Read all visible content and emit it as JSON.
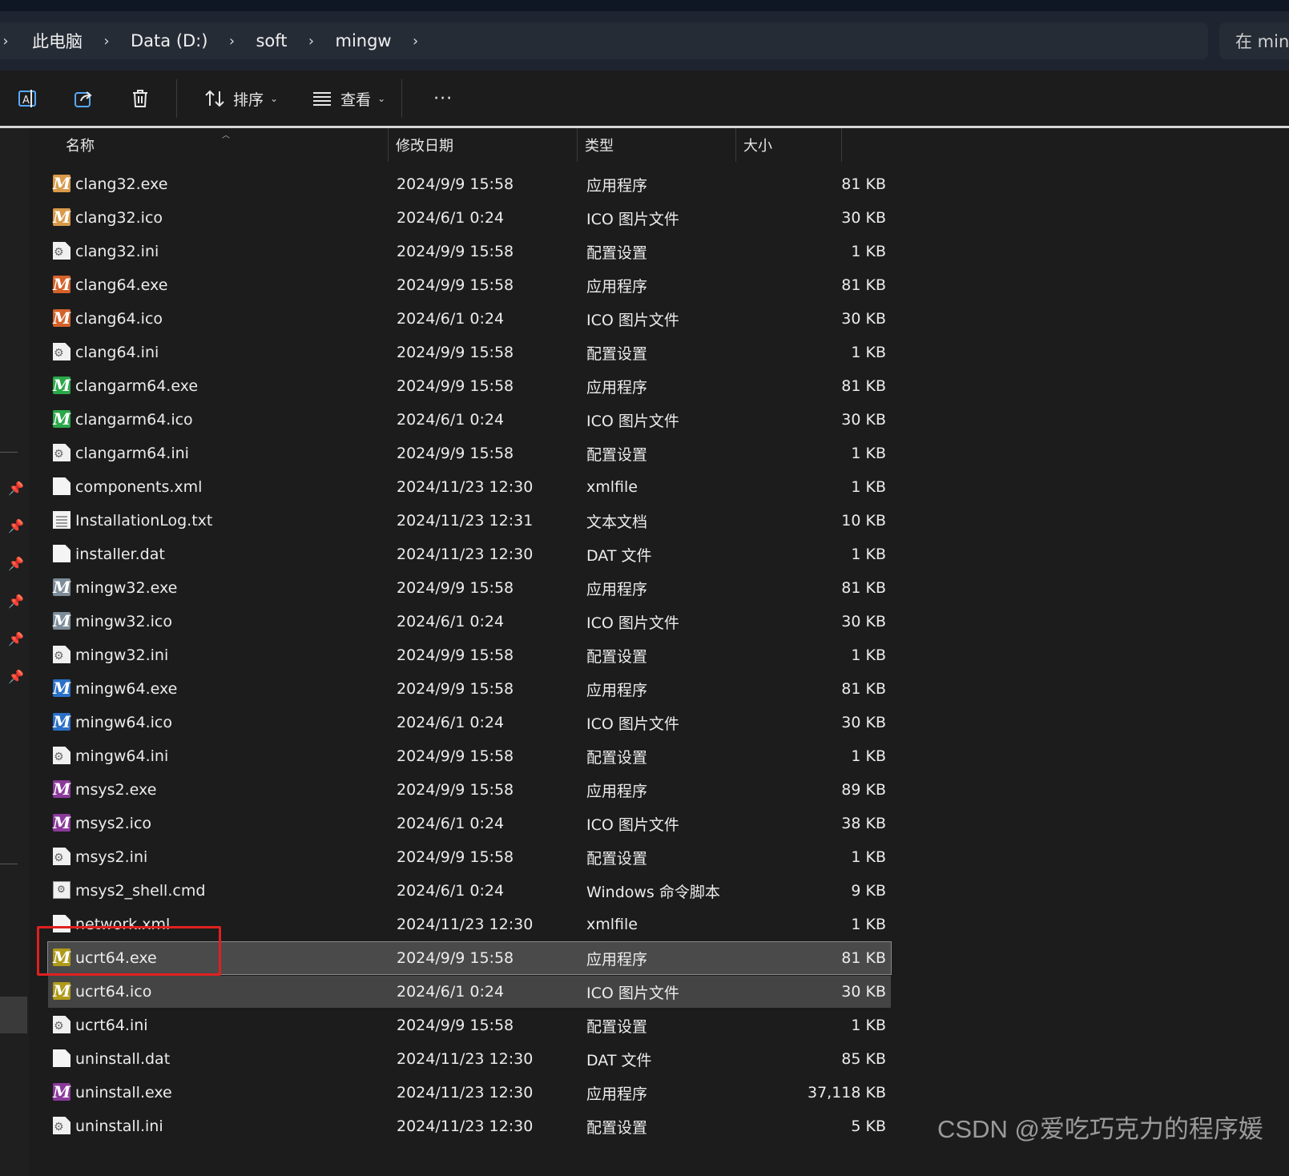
{
  "breadcrumb": {
    "items": [
      "此电脑",
      "Data (D:)",
      "soft",
      "mingw"
    ],
    "separator": "›"
  },
  "search": {
    "placeholder": "在 mingw"
  },
  "toolbar": {
    "sort_label": "排序",
    "view_label": "查看",
    "more_label": "···"
  },
  "columns": {
    "name": "名称",
    "date": "修改日期",
    "type": "类型",
    "size": "大小"
  },
  "colors": {
    "clang32": "#d89a4a",
    "clang64": "#d4622a",
    "clangarm64": "#2aa84a",
    "mingw32": "#7c8c98",
    "mingw64": "#2a70c8",
    "msys2": "#8a3a9a",
    "ucrt64": "#b09a1a",
    "selection_box": "#e02020"
  },
  "files": [
    {
      "name": "clang32.exe",
      "date": "2024/9/9 15:58",
      "type": "应用程序",
      "size": "81 KB",
      "icon": "m-clang32"
    },
    {
      "name": "clang32.ico",
      "date": "2024/6/1 0:24",
      "type": "ICO 图片文件",
      "size": "30 KB",
      "icon": "m-clang32"
    },
    {
      "name": "clang32.ini",
      "date": "2024/9/9 15:58",
      "type": "配置设置",
      "size": "1 KB",
      "icon": "ini"
    },
    {
      "name": "clang64.exe",
      "date": "2024/9/9 15:58",
      "type": "应用程序",
      "size": "81 KB",
      "icon": "m-clang64"
    },
    {
      "name": "clang64.ico",
      "date": "2024/6/1 0:24",
      "type": "ICO 图片文件",
      "size": "30 KB",
      "icon": "m-clang64"
    },
    {
      "name": "clang64.ini",
      "date": "2024/9/9 15:58",
      "type": "配置设置",
      "size": "1 KB",
      "icon": "ini"
    },
    {
      "name": "clangarm64.exe",
      "date": "2024/9/9 15:58",
      "type": "应用程序",
      "size": "81 KB",
      "icon": "m-clangarm64"
    },
    {
      "name": "clangarm64.ico",
      "date": "2024/6/1 0:24",
      "type": "ICO 图片文件",
      "size": "30 KB",
      "icon": "m-clangarm64"
    },
    {
      "name": "clangarm64.ini",
      "date": "2024/9/9 15:58",
      "type": "配置设置",
      "size": "1 KB",
      "icon": "ini"
    },
    {
      "name": "components.xml",
      "date": "2024/11/23 12:30",
      "type": "xmlfile",
      "size": "1 KB",
      "icon": "doc"
    },
    {
      "name": "InstallationLog.txt",
      "date": "2024/11/23 12:31",
      "type": "文本文档",
      "size": "10 KB",
      "icon": "txt"
    },
    {
      "name": "installer.dat",
      "date": "2024/11/23 12:30",
      "type": "DAT 文件",
      "size": "1 KB",
      "icon": "doc"
    },
    {
      "name": "mingw32.exe",
      "date": "2024/9/9 15:58",
      "type": "应用程序",
      "size": "81 KB",
      "icon": "m-mingw32"
    },
    {
      "name": "mingw32.ico",
      "date": "2024/6/1 0:24",
      "type": "ICO 图片文件",
      "size": "30 KB",
      "icon": "m-mingw32"
    },
    {
      "name": "mingw32.ini",
      "date": "2024/9/9 15:58",
      "type": "配置设置",
      "size": "1 KB",
      "icon": "ini"
    },
    {
      "name": "mingw64.exe",
      "date": "2024/9/9 15:58",
      "type": "应用程序",
      "size": "81 KB",
      "icon": "m-mingw64"
    },
    {
      "name": "mingw64.ico",
      "date": "2024/6/1 0:24",
      "type": "ICO 图片文件",
      "size": "30 KB",
      "icon": "m-mingw64"
    },
    {
      "name": "mingw64.ini",
      "date": "2024/9/9 15:58",
      "type": "配置设置",
      "size": "1 KB",
      "icon": "ini"
    },
    {
      "name": "msys2.exe",
      "date": "2024/9/9 15:58",
      "type": "应用程序",
      "size": "89 KB",
      "icon": "m-msys2"
    },
    {
      "name": "msys2.ico",
      "date": "2024/6/1 0:24",
      "type": "ICO 图片文件",
      "size": "38 KB",
      "icon": "m-msys2"
    },
    {
      "name": "msys2.ini",
      "date": "2024/9/9 15:58",
      "type": "配置设置",
      "size": "1 KB",
      "icon": "ini"
    },
    {
      "name": "msys2_shell.cmd",
      "date": "2024/6/1 0:24",
      "type": "Windows 命令脚本",
      "size": "9 KB",
      "icon": "cmd"
    },
    {
      "name": "network.xml",
      "date": "2024/11/23 12:30",
      "type": "xmlfile",
      "size": "1 KB",
      "icon": "doc"
    },
    {
      "name": "ucrt64.exe",
      "date": "2024/9/9 15:58",
      "type": "应用程序",
      "size": "81 KB",
      "icon": "m-ucrt64",
      "selected": "focus"
    },
    {
      "name": "ucrt64.ico",
      "date": "2024/6/1 0:24",
      "type": "ICO 图片文件",
      "size": "30 KB",
      "icon": "m-ucrt64",
      "selected": "yes"
    },
    {
      "name": "ucrt64.ini",
      "date": "2024/9/9 15:58",
      "type": "配置设置",
      "size": "1 KB",
      "icon": "ini"
    },
    {
      "name": "uninstall.dat",
      "date": "2024/11/23 12:30",
      "type": "DAT 文件",
      "size": "85 KB",
      "icon": "doc"
    },
    {
      "name": "uninstall.exe",
      "date": "2024/11/23 12:30",
      "type": "应用程序",
      "size": "37,118 KB",
      "icon": "m-msys2"
    },
    {
      "name": "uninstall.ini",
      "date": "2024/11/23 12:30",
      "type": "配置设置",
      "size": "5 KB",
      "icon": "ini"
    }
  ],
  "watermark": "CSDN @爱吃巧克力的程序媛"
}
